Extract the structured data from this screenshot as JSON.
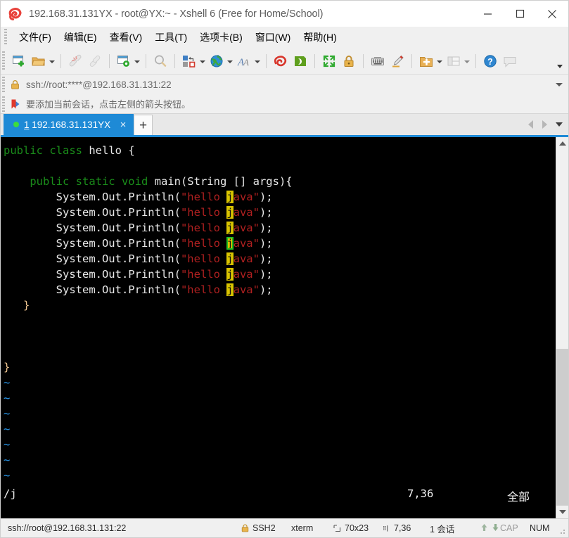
{
  "window": {
    "title": "192.168.31.131YX - root@YX:~ - Xshell 6 (Free for Home/School)",
    "logo_icon": "xshell-logo-icon",
    "minimize_label": "─",
    "maximize_label": "□",
    "close_label": "✕"
  },
  "menubar": {
    "items": [
      {
        "label": "文件(F)",
        "name": "menu-file"
      },
      {
        "label": "编辑(E)",
        "name": "menu-edit"
      },
      {
        "label": "查看(V)",
        "name": "menu-view"
      },
      {
        "label": "工具(T)",
        "name": "menu-tools"
      },
      {
        "label": "选项卡(B)",
        "name": "menu-tabs"
      },
      {
        "label": "窗口(W)",
        "name": "menu-window"
      },
      {
        "label": "帮助(H)",
        "name": "menu-help"
      }
    ]
  },
  "toolbar": {
    "icons": [
      "new-session-icon",
      "open-folder-icon",
      "disconnect-icon",
      "reconnect-icon",
      "session-properties-icon",
      "find-icon",
      "transfer-file-icon",
      "globe-icon",
      "font-icon",
      "log-icon",
      "nethelper-icon",
      "fullscreen-icon",
      "lock-icon",
      "keyboard-icon",
      "highlight-icon",
      "new-folder-icon",
      "layout-icon",
      "help-icon",
      "comment-icon"
    ],
    "overflow_label": "More toolbar buttons"
  },
  "address": {
    "lock_icon": "lock-icon",
    "value": "ssh://root:****@192.168.31.131:22",
    "placeholder": "ssh://",
    "dropdown_icon": "chevron-down-icon"
  },
  "hint": {
    "icon": "bookmark-arrow-icon",
    "text": "要添加当前会话，点击左侧的箭头按钮。"
  },
  "tabs": {
    "active": {
      "index": "1",
      "name": "192.168.31.131YX",
      "close_label": "×",
      "status_dot_color": "#3ddc3d"
    },
    "new_tab_label": "+",
    "scroll_left_icon": "chevron-left-icon",
    "scroll_right_icon": "chevron-right-icon",
    "tab_list_icon": "chevron-down-icon"
  },
  "terminal": {
    "rows": 23,
    "cols": 70,
    "lines": [
      {
        "segs": [
          {
            "t": "public class ",
            "c": "kw"
          },
          {
            "t": "hello {",
            "c": "plain"
          }
        ]
      },
      {
        "segs": []
      },
      {
        "segs": [
          {
            "t": "    ",
            "c": "plain"
          },
          {
            "t": "public static void ",
            "c": "kw"
          },
          {
            "t": "main(String [] args){",
            "c": "plain"
          }
        ]
      },
      {
        "segs": [
          {
            "t": "        System.Out.Println(",
            "c": "plain"
          },
          {
            "t": "\"hello ",
            "c": "str"
          },
          {
            "t": "j",
            "c": "hl"
          },
          {
            "t": "ava\"",
            "c": "str"
          },
          {
            "t": ");",
            "c": "plain"
          }
        ]
      },
      {
        "segs": [
          {
            "t": "        System.Out.Println(",
            "c": "plain"
          },
          {
            "t": "\"hello ",
            "c": "str"
          },
          {
            "t": "j",
            "c": "hl"
          },
          {
            "t": "ava\"",
            "c": "str"
          },
          {
            "t": ");",
            "c": "plain"
          }
        ]
      },
      {
        "segs": [
          {
            "t": "        System.Out.Println(",
            "c": "plain"
          },
          {
            "t": "\"hello ",
            "c": "str"
          },
          {
            "t": "j",
            "c": "hl"
          },
          {
            "t": "ava\"",
            "c": "str"
          },
          {
            "t": ");",
            "c": "plain"
          }
        ]
      },
      {
        "segs": [
          {
            "t": "        System.Out.Println(",
            "c": "plain"
          },
          {
            "t": "\"hello ",
            "c": "str"
          },
          {
            "t": "j",
            "c": "hl cursor"
          },
          {
            "t": "ava\"",
            "c": "str"
          },
          {
            "t": ");",
            "c": "plain"
          }
        ]
      },
      {
        "segs": [
          {
            "t": "        System.Out.Println(",
            "c": "plain"
          },
          {
            "t": "\"hello ",
            "c": "str"
          },
          {
            "t": "j",
            "c": "hl"
          },
          {
            "t": "ava\"",
            "c": "str"
          },
          {
            "t": ");",
            "c": "plain"
          }
        ]
      },
      {
        "segs": [
          {
            "t": "        System.Out.Println(",
            "c": "plain"
          },
          {
            "t": "\"hello ",
            "c": "str"
          },
          {
            "t": "j",
            "c": "hl"
          },
          {
            "t": "ava\"",
            "c": "str"
          },
          {
            "t": ");",
            "c": "plain"
          }
        ]
      },
      {
        "segs": [
          {
            "t": "        System.Out.Println(",
            "c": "plain"
          },
          {
            "t": "\"hello ",
            "c": "str"
          },
          {
            "t": "j",
            "c": "hl"
          },
          {
            "t": "ava\"",
            "c": "str"
          },
          {
            "t": ");",
            "c": "plain"
          }
        ]
      },
      {
        "segs": [
          {
            "t": "   ",
            "c": "plain"
          },
          {
            "t": "}",
            "c": "brace"
          }
        ]
      },
      {
        "segs": []
      },
      {
        "segs": []
      },
      {
        "segs": []
      },
      {
        "segs": [
          {
            "t": "}",
            "c": "brace"
          }
        ]
      },
      {
        "segs": [
          {
            "t": "~",
            "c": "tilde"
          }
        ]
      },
      {
        "segs": [
          {
            "t": "~",
            "c": "tilde"
          }
        ]
      },
      {
        "segs": [
          {
            "t": "~",
            "c": "tilde"
          }
        ]
      },
      {
        "segs": [
          {
            "t": "~",
            "c": "tilde"
          }
        ]
      },
      {
        "segs": [
          {
            "t": "~",
            "c": "tilde"
          }
        ]
      },
      {
        "segs": [
          {
            "t": "~",
            "c": "tilde"
          }
        ]
      },
      {
        "segs": [
          {
            "t": "~",
            "c": "tilde"
          }
        ]
      }
    ],
    "status": {
      "command": "/j",
      "position": "7,36",
      "scroll_state": "全部"
    }
  },
  "statusbar": {
    "url": "ssh://root@192.168.31.131:22",
    "protocol": "SSH2",
    "protocol_icon": "lock-icon",
    "term_type": "xterm",
    "size_icon": "screen-size-icon",
    "size": "70x23",
    "cursor_icon": "cursor-pos-icon",
    "cursor": "7,36",
    "sessions": "1 会话",
    "upload_icon": "arrow-up-icon",
    "download_icon": "arrow-down-icon",
    "caps": "CAP",
    "num": "NUM",
    "resize_grip_icon": "resize-grip-icon"
  }
}
